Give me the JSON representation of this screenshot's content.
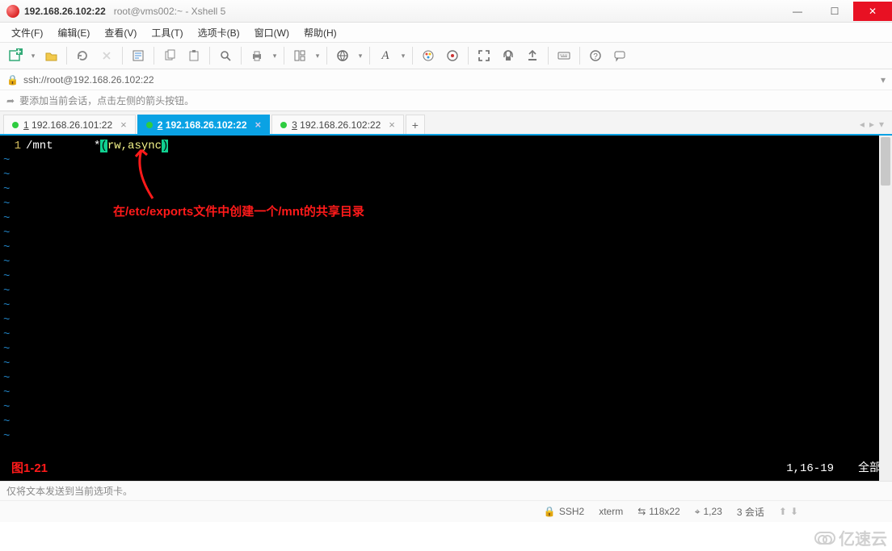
{
  "window": {
    "title_main": "192.168.26.102:22",
    "title_sub": "root@vms002:~ - Xshell 5"
  },
  "menu": {
    "file": "文件(F)",
    "edit": "编辑(E)",
    "view": "查看(V)",
    "tools": "工具(T)",
    "tabs": "选项卡(B)",
    "window": "窗口(W)",
    "help": "帮助(H)"
  },
  "address": {
    "value": "ssh://root@192.168.26.102:22"
  },
  "hint": {
    "text": "要添加当前会话，点击左侧的箭头按钮。"
  },
  "tabs": [
    {
      "index": "1",
      "label": "192.168.26.101:22",
      "active": false
    },
    {
      "index": "2",
      "label": "192.168.26.102:22",
      "active": true
    },
    {
      "index": "3",
      "label": "192.168.26.102:22",
      "active": false
    }
  ],
  "terminal": {
    "line1": {
      "num": "1",
      "path": "/mnt",
      "gap": "      ",
      "star": "*",
      "p1": "(",
      "inner": "rw,async",
      "p2": ")"
    },
    "annotation": "在/etc/exports文件中创建一个/mnt的共享目录",
    "figure_label": "图1-21",
    "pos": "1,16-19",
    "scope": "全部"
  },
  "status": {
    "input_hint": "仅将文本发送到当前选项卡。",
    "proto": "SSH2",
    "termtype": "xterm",
    "size": "118x22",
    "cursor": "1,23",
    "sessions_label": "3 会话",
    "sessions_icons": "↑ ↓"
  },
  "watermark": "亿速云",
  "icons": {
    "lock": "🔒",
    "arrow": "➦",
    "plus": "＋",
    "minus": "−",
    "square": "☐",
    "cross": "✕",
    "size_sym": "⇆",
    "cursor_sym": "⌖"
  }
}
